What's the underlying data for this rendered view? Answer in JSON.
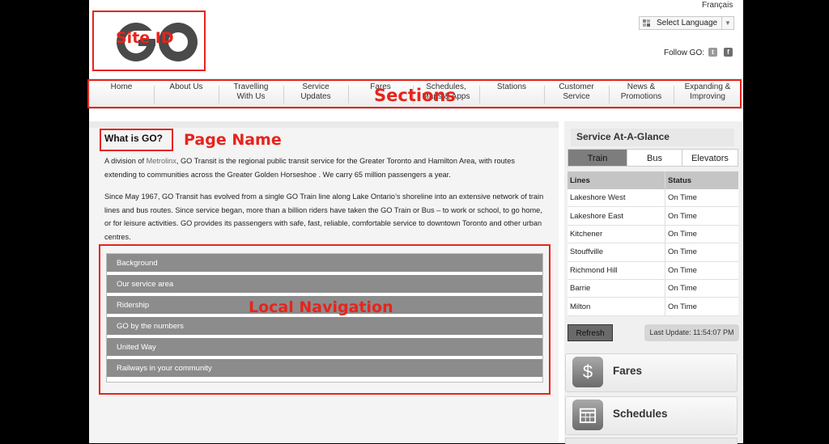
{
  "header": {
    "language_link": "Français",
    "language_select": "Select Language",
    "follow_label": "Follow GO:",
    "social": [
      "twitter-icon",
      "facebook-icon"
    ]
  },
  "logo": {
    "text": "GO"
  },
  "nav": {
    "items": [
      {
        "label": "Home"
      },
      {
        "label": "About Us"
      },
      {
        "label": "Travelling\nWith Us"
      },
      {
        "label": "Service\nUpdates"
      },
      {
        "label": "Fares"
      },
      {
        "label": "Schedules,\nMaps & Apps"
      },
      {
        "label": "Stations"
      },
      {
        "label": "Customer\nService"
      },
      {
        "label": "News &\nPromotions"
      },
      {
        "label": "Expanding &\nImproving"
      }
    ]
  },
  "main": {
    "title": "What is GO?",
    "para1_prefix": "A division of ",
    "para1_link": "Metrolinx",
    "para1_rest": ", GO Transit is the regional public transit service for the Greater Toronto and Hamilton Area, with routes extending to communities across the Greater Golden Horseshoe . We carry 65 million passengers a year.",
    "para2": "Since May 1967, GO Transit has evolved from a single GO Train line along Lake Ontario’s shoreline into an extensive network of train lines and bus routes. Since service began, more than a billion riders have taken the GO Train or Bus – to work or school, to go home, or for leisure activities. GO provides its passengers with safe, fast, reliable, comfortable service to downtown Toronto and other urban centres.",
    "local_nav": [
      "Background",
      "Our service area",
      "Ridership",
      "GO by the numbers",
      "United Way",
      "Railways in your community"
    ]
  },
  "service": {
    "title": "Service At-A-Glance",
    "tabs": [
      "Train",
      "Bus",
      "Elevators"
    ],
    "active_tab": "Train",
    "headers": [
      "Lines",
      "Status"
    ],
    "rows": [
      [
        "Lakeshore West",
        "On Time"
      ],
      [
        "Lakeshore East",
        "On Time"
      ],
      [
        "Kitchener",
        "On Time"
      ],
      [
        "Stouffville",
        "On Time"
      ],
      [
        "Richmond Hill",
        "On Time"
      ],
      [
        "Barrie",
        "On Time"
      ],
      [
        "Milton",
        "On Time"
      ]
    ],
    "refresh_label": "Refresh",
    "last_update": "Last Update: 11:54:07 PM"
  },
  "quick_links": [
    {
      "label": "Fares",
      "icon": "dollar-icon"
    },
    {
      "label": "Schedules",
      "icon": "calendar-icon"
    }
  ],
  "annotations": {
    "site_id": "Site ID",
    "sections": "Sections",
    "page_name": "Page Name",
    "local_navigation": "Local Navigation",
    "color": "#e8231b"
  }
}
